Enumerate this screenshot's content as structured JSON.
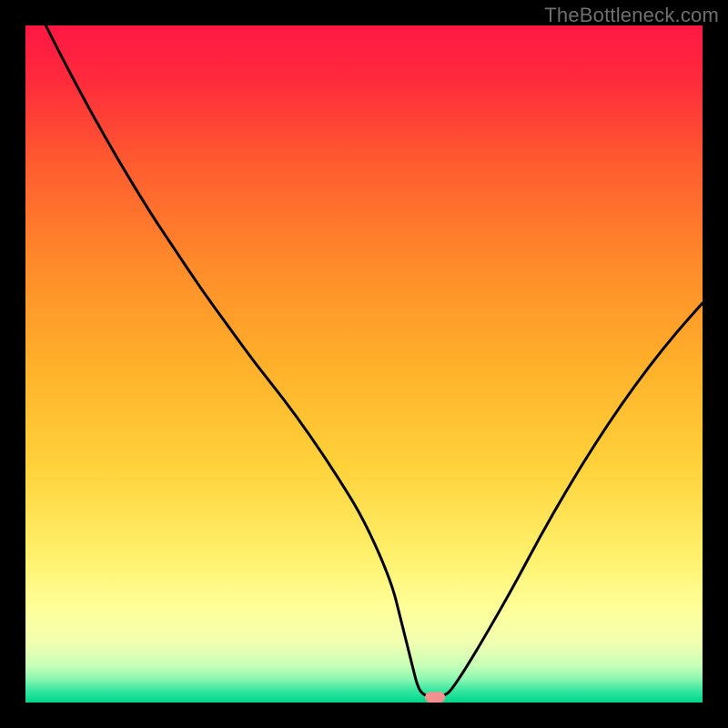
{
  "watermark": "TheBottleneck.com",
  "chart_data": {
    "type": "line",
    "title": "",
    "xlabel": "",
    "ylabel": "",
    "xlim": [
      0,
      100
    ],
    "ylim": [
      0,
      100
    ],
    "series": [
      {
        "name": "curve",
        "x": [
          0,
          6,
          12,
          18,
          22,
          26,
          30,
          34,
          38,
          42,
          46,
          50,
          54,
          55.5,
          57,
          58,
          59,
          60,
          62,
          63,
          65,
          68,
          72,
          76,
          80,
          84,
          88,
          92,
          96,
          100
        ],
        "y": [
          106,
          94,
          83,
          73,
          67,
          61,
          55.5,
          50,
          45,
          39.5,
          33.5,
          27,
          18,
          12,
          6,
          2,
          1,
          1,
          1,
          2,
          5,
          10,
          17,
          24.5,
          31.5,
          38,
          44,
          49.5,
          54.5,
          59
        ]
      }
    ],
    "optimum_marker": {
      "x": 60.5,
      "y": 0.5
    },
    "gradient_stops": [
      {
        "offset": 0.0,
        "color": "#ff1744"
      },
      {
        "offset": 0.08,
        "color": "#ff2a3c"
      },
      {
        "offset": 0.2,
        "color": "#ff5a2f"
      },
      {
        "offset": 0.35,
        "color": "#ff8a2a"
      },
      {
        "offset": 0.5,
        "color": "#ffb02a"
      },
      {
        "offset": 0.65,
        "color": "#ffd23a"
      },
      {
        "offset": 0.78,
        "color": "#fff06a"
      },
      {
        "offset": 0.86,
        "color": "#ffff99"
      },
      {
        "offset": 0.91,
        "color": "#f2ffb0"
      },
      {
        "offset": 0.945,
        "color": "#c8ffb8"
      },
      {
        "offset": 0.965,
        "color": "#8cf7b2"
      },
      {
        "offset": 0.983,
        "color": "#33e6a0"
      },
      {
        "offset": 1.0,
        "color": "#00d68a"
      }
    ]
  }
}
